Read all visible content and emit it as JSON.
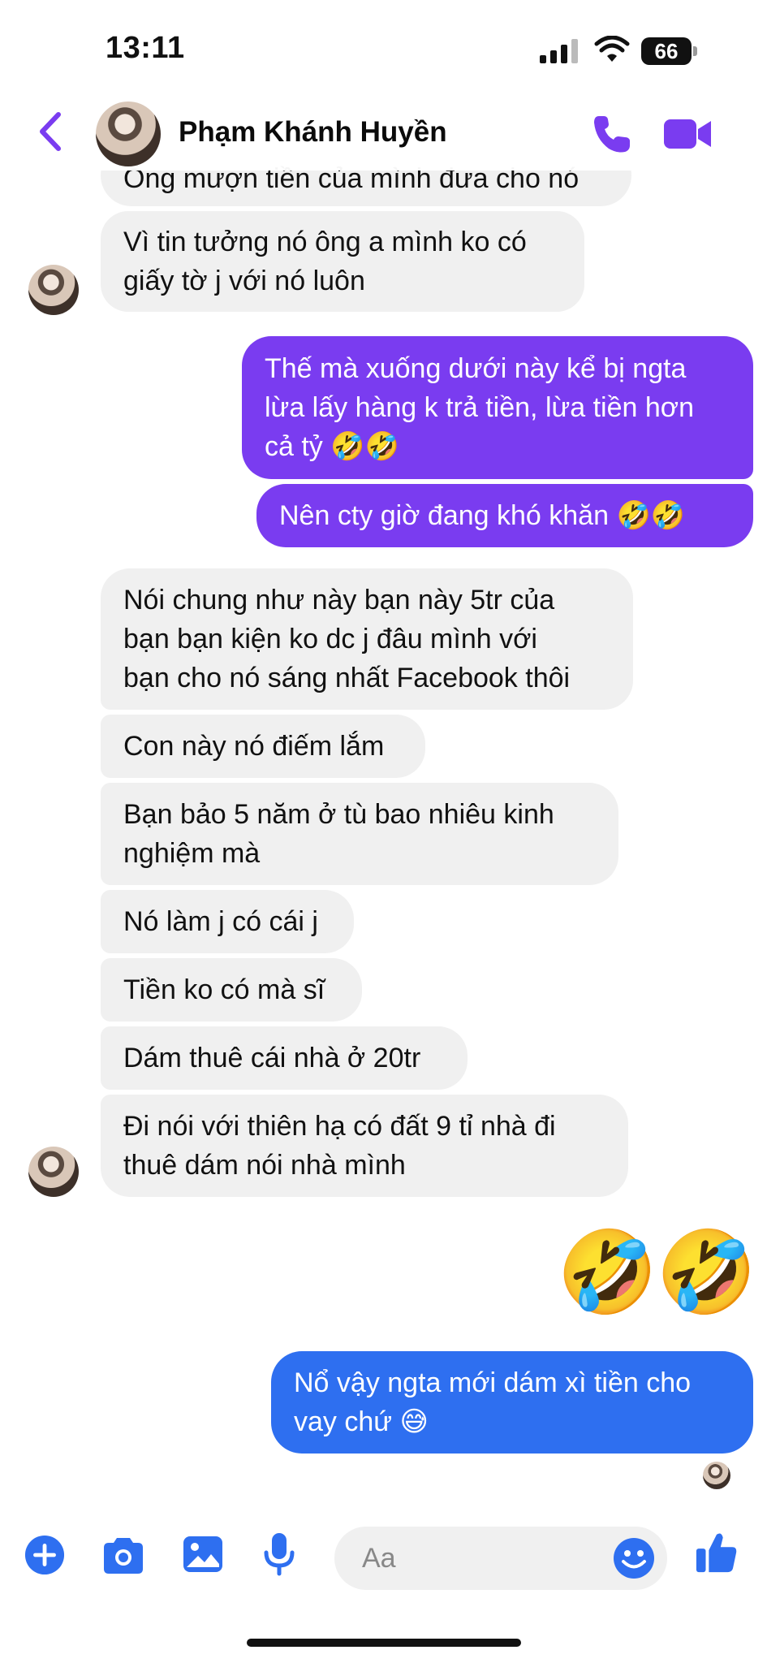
{
  "status_bar": {
    "time": "13:11",
    "battery": "66"
  },
  "header": {
    "contact_name": "Phạm Khánh Huyền"
  },
  "messages": [
    {
      "text": "Ông mượn tiền của mình đưa cho nó"
    },
    {
      "text": "Vì tin tưởng nó ông a mình ko có\ngiấy tờ j với nó luôn"
    },
    {
      "text": "Thế mà xuống dưới này kể bị ngta\nlừa lấy hàng k trả tiền, lừa tiền hơn\ncả tỷ 🤣🤣"
    },
    {
      "text": "Nên cty giờ đang khó khăn 🤣🤣"
    },
    {
      "text": "Nói chung như này bạn này 5tr của\nbạn bạn kiện ko dc j đâu mình với\nbạn cho nó sáng nhất Facebook thôi"
    },
    {
      "text": "Con này nó điếm lắm"
    },
    {
      "text": "Bạn bảo 5 năm ở tù bao nhiêu kinh\nnghiệm mà"
    },
    {
      "text": "Nó làm j có cái j"
    },
    {
      "text": "Tiền ko có mà sĩ"
    },
    {
      "text": "Dám thuê cái nhà ở 20tr"
    },
    {
      "text": "Đi nói với thiên hạ có đất 9 tỉ nhà đi\nthuê dám nói nhà mình"
    },
    {
      "text": "🤣"
    },
    {
      "text": "🤣"
    },
    {
      "text": "Nổ vậy ngta mới dám xì tiền cho\nvay chứ 😅"
    }
  ],
  "composer": {
    "placeholder": "Aa"
  },
  "colors": {
    "accent": "#7a3cf0",
    "outgoing_purple": "#7a3cf0",
    "outgoing_blue": "#2e6ff0",
    "incoming": "#f0f0f0",
    "composer_icon": "#2e6ff0"
  },
  "icons": [
    "back-chevron-icon",
    "phone-icon",
    "video-camera-icon",
    "plus-icon",
    "camera-icon",
    "image-icon",
    "microphone-icon",
    "emoji-icon",
    "thumbs-up-icon"
  ]
}
